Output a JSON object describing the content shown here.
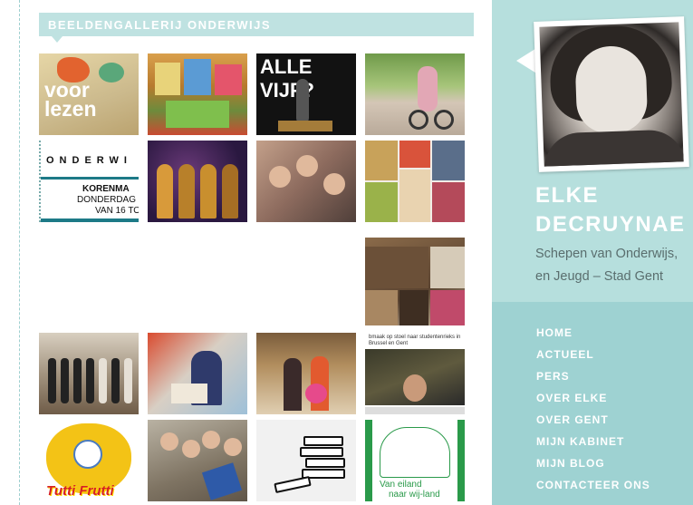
{
  "gallery": {
    "title": "BEELDENGALLERIJ ONDERWIJS",
    "thumbs": {
      "voorlezen": "voor\nlezen",
      "allevijf": "ALLE VIJF?",
      "onderwijs_line1": "ONDERWI",
      "onderwijs_line2": "KORENMA",
      "onderwijs_line3": "DONDERDAG",
      "onderwijs_line4": "VAN 16 TO",
      "video_caption": "bmaak op stoel naar studentenrieks in Brussel en Gent",
      "tutti": "Tutti Frutti",
      "tree_line1": "Van eiland",
      "tree_line2": "naar wij-land"
    }
  },
  "sidebar": {
    "name_line1": "ELKE",
    "name_line2": "DECRUYNAE",
    "role_line1": "Schepen van Onderwijs,",
    "role_line2": "en Jeugd – Stad Gent",
    "nav": [
      "HOME",
      "ACTUEEL",
      "PERS",
      "OVER ELKE",
      "OVER GENT",
      "MIJN KABINET",
      "MIJN BLOG",
      "CONTACTEER ONS"
    ]
  },
  "colors": {
    "header_bg": "#bfe2e1",
    "sidebar_top": "#b6dfdd",
    "sidebar_bottom": "#9ed2d2"
  }
}
